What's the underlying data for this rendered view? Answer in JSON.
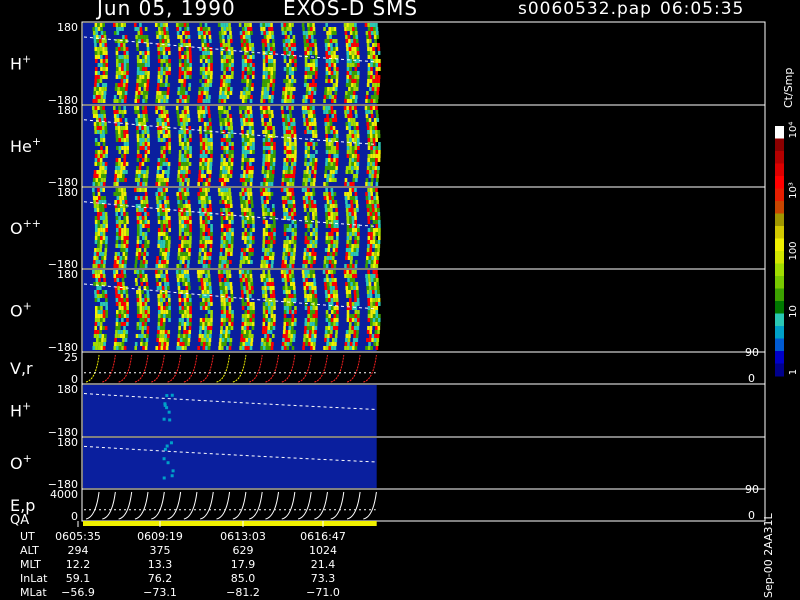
{
  "header": {
    "date": "Jun 05, 1990",
    "instrument": "EXOS-D SMS",
    "file": "s0060532.pap",
    "time": "06:05:35"
  },
  "colorbar": {
    "unit_label": "Ct/Smp",
    "tick_labels": [
      "1",
      "10",
      "100",
      "10³",
      "10⁴"
    ],
    "tick_values": [
      1,
      10,
      100,
      1000,
      10000
    ],
    "colors": [
      "#00008c",
      "#0000c8",
      "#005ad2",
      "#00a0c8",
      "#2ac8b4",
      "#007800",
      "#3ca000",
      "#78c800",
      "#a0dc00",
      "#d2e600",
      "#f0f000",
      "#d2c800",
      "#a09600",
      "#c84600",
      "#e61e00",
      "#ff0000",
      "#dc0000",
      "#b40000",
      "#8c0000",
      "#ffffff"
    ]
  },
  "footer": {
    "side_text": "Sep-00 2AA31L",
    "row_labels": [
      "UT",
      "ALT",
      "MLT",
      "InLat",
      "MLat"
    ],
    "columns": [
      [
        "0605:35",
        "294",
        "12.2",
        "59.1",
        "−56.9"
      ],
      [
        "0609:19",
        "375",
        "13.3",
        "76.2",
        "−73.1"
      ],
      [
        "0613:03",
        "629",
        "17.9",
        "85.0",
        "−81.2"
      ],
      [
        "0616:47",
        "1024",
        "21.4",
        "73.3",
        "−71.0"
      ]
    ]
  },
  "chart_data": {
    "type": "heatmap",
    "panels": [
      {
        "label": "H",
        "label_sup": "+",
        "y_top": "180",
        "y_bottom": "−180",
        "ylim": [
          -180,
          180
        ],
        "data_extent": 0.48
      },
      {
        "label": "He",
        "label_sup": "+",
        "y_top": "180",
        "y_bottom": "−180",
        "ylim": [
          -180,
          180
        ],
        "data_extent": 0.48
      },
      {
        "label": "O",
        "label_sup": "++",
        "y_top": "180",
        "y_bottom": "−180",
        "ylim": [
          -180,
          180
        ],
        "data_extent": 0.48
      },
      {
        "label": "O",
        "label_sup": "+",
        "y_top": "180",
        "y_bottom": "−180",
        "ylim": [
          -180,
          180
        ],
        "data_extent": 0.48
      },
      {
        "label": "V,r",
        "label_sup": "",
        "y_top": "25",
        "y_bottom": "0",
        "right_top": "90",
        "right_bottom": "0",
        "ylim": [
          0,
          25
        ]
      },
      {
        "label": "H",
        "label_sup": "+",
        "y_top": "180",
        "y_bottom": "−180",
        "ylim": [
          -180,
          180
        ],
        "data_extent": 0.48
      },
      {
        "label": "O",
        "label_sup": "+",
        "y_top": "180",
        "y_bottom": "−180",
        "ylim": [
          -180,
          180
        ],
        "data_extent": 0.48
      },
      {
        "label": "E,p",
        "label_sup": "",
        "y_top": "4000",
        "y_bottom": "0",
        "right_top": "90",
        "right_bottom": "0",
        "ylim": [
          0,
          4000
        ]
      }
    ],
    "qa_label": "QA",
    "x_ticks": [
      "0605:35",
      "0609:19",
      "0613:03",
      "0616:47"
    ]
  }
}
